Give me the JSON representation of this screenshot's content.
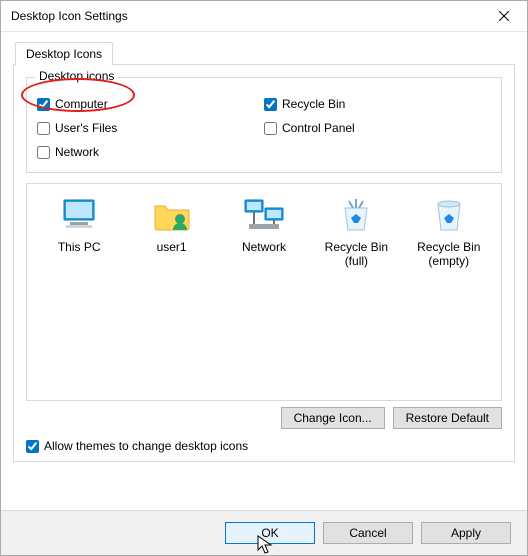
{
  "window": {
    "title": "Desktop Icon Settings"
  },
  "tabs": {
    "desktop_icons": "Desktop Icons"
  },
  "group": {
    "title": "Desktop icons",
    "computer": {
      "label": "Computer",
      "checked": true
    },
    "recycle_bin": {
      "label": "Recycle Bin",
      "checked": true
    },
    "users_files": {
      "label": "User's Files",
      "checked": false
    },
    "control_panel": {
      "label": "Control Panel",
      "checked": false
    },
    "network": {
      "label": "Network",
      "checked": false
    }
  },
  "preview": {
    "this_pc": "This PC",
    "user": "user1",
    "network": "Network",
    "recycle_full": "Recycle Bin (full)",
    "recycle_empty": "Recycle Bin (empty)"
  },
  "allow_themes": {
    "label": "Allow themes to change desktop icons",
    "checked": true
  },
  "buttons": {
    "change_icon": "Change Icon...",
    "restore_default": "Restore Default",
    "ok": "OK",
    "cancel": "Cancel",
    "apply": "Apply"
  },
  "highlight": {
    "target": "computer-checkbox"
  }
}
